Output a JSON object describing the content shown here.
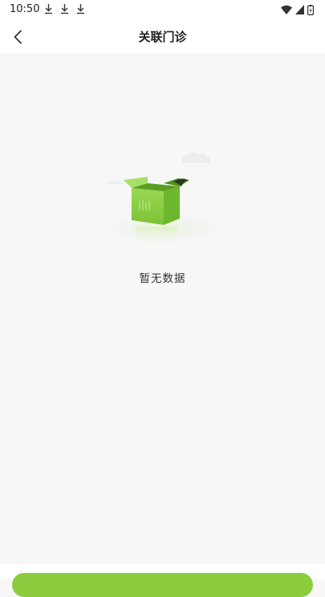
{
  "status_bar": {
    "time": "10:50",
    "download_icon_count": 3
  },
  "nav": {
    "title": "关联门诊"
  },
  "empty_state": {
    "message": "暂无数据"
  },
  "colors": {
    "accent": "#8ccd3f",
    "box_front": "#8fd14a",
    "box_side": "#6db62d",
    "background": "#f7f7f8"
  }
}
